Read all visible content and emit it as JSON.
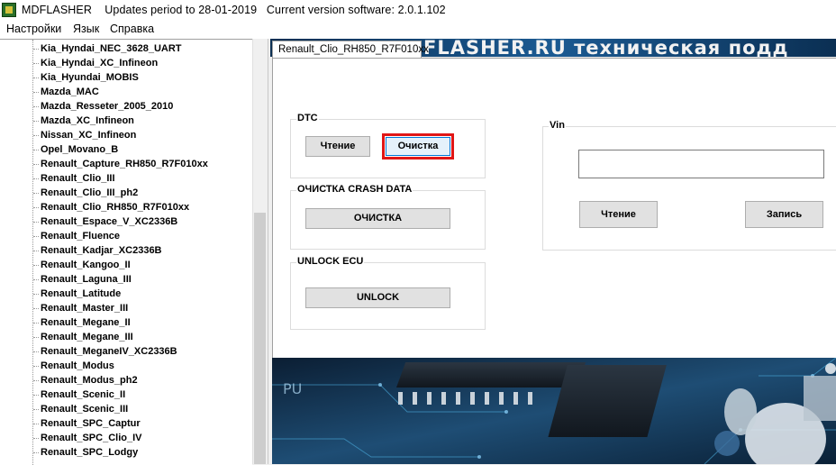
{
  "window": {
    "app_name": "MDFLASHER",
    "updates": "Updates period to 28-01-2019",
    "version": "Current version software: 2.0.1.102"
  },
  "menu": {
    "items": [
      "Настройки",
      "Язык",
      "Справка"
    ]
  },
  "tree": {
    "items": [
      "Kia_Hyndai_NEC_3628_UART",
      "Kia_Hyndai_XC_Infineon",
      "Kia_Hyundai_MOBIS",
      "Mazda_MAC",
      "Mazda_Resseter_2005_2010",
      "Mazda_XC_Infineon",
      "Nissan_XC_Infineon",
      "Opel_Movano_B",
      "Renault_Capture_RH850_R7F010xx",
      "Renault_Clio_III",
      "Renault_Clio_III_ph2",
      "Renault_Clio_RH850_R7F010xx",
      "Renault_Espace_V_XC2336B",
      "Renault_Fluence",
      "Renault_Kadjar_XC2336B",
      "Renault_Kangoo_II",
      "Renault_Laguna_III",
      "Renault_Latitude",
      "Renault_Master_III",
      "Renault_Megane_II",
      "Renault_Megane_III",
      "Renault_MeganeIV_XC2336B",
      "Renault_Modus",
      "Renault_Modus_ph2",
      "Renault_Scenic_II",
      "Renault_Scenic_III",
      "Renault_SPC_Captur",
      "Renault_SPC_Clio_IV",
      "Renault_SPC_Lodgy"
    ]
  },
  "banner": {
    "text": "FLASHER.RU техническая подд"
  },
  "tab": {
    "label": "Renault_Clio_RH850_R7F010xx"
  },
  "dtc": {
    "title": "DTC",
    "read_label": "Чтение",
    "clear_label": "Очистка"
  },
  "crash": {
    "title": "ОЧИСТКА CRASH DATA",
    "clear_label": "ОЧИСТКА"
  },
  "unlock": {
    "title": "UNLOCK ECU",
    "button_label": "UNLOCK"
  },
  "vin": {
    "title": "Vin",
    "value": "",
    "read_label": "Чтение",
    "write_label": "Запись"
  },
  "bottom_image": {
    "chip_text_1": "PU"
  },
  "colors": {
    "highlight": "#e01616",
    "banner_dark": "#0b2f53",
    "banner_light": "#1b5a92"
  }
}
